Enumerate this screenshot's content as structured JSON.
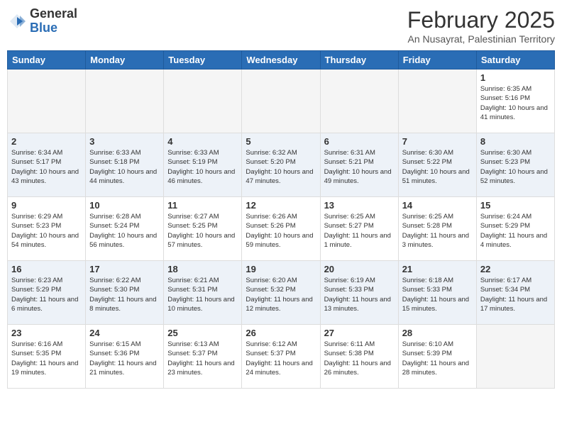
{
  "header": {
    "logo_general": "General",
    "logo_blue": "Blue",
    "month_title": "February 2025",
    "subtitle": "An Nusayrat, Palestinian Territory"
  },
  "days_of_week": [
    "Sunday",
    "Monday",
    "Tuesday",
    "Wednesday",
    "Thursday",
    "Friday",
    "Saturday"
  ],
  "weeks": [
    {
      "days": [
        {
          "num": "",
          "info": ""
        },
        {
          "num": "",
          "info": ""
        },
        {
          "num": "",
          "info": ""
        },
        {
          "num": "",
          "info": ""
        },
        {
          "num": "",
          "info": ""
        },
        {
          "num": "",
          "info": ""
        },
        {
          "num": "1",
          "info": "Sunrise: 6:35 AM\nSunset: 5:16 PM\nDaylight: 10 hours and 41 minutes."
        }
      ]
    },
    {
      "days": [
        {
          "num": "2",
          "info": "Sunrise: 6:34 AM\nSunset: 5:17 PM\nDaylight: 10 hours and 43 minutes."
        },
        {
          "num": "3",
          "info": "Sunrise: 6:33 AM\nSunset: 5:18 PM\nDaylight: 10 hours and 44 minutes."
        },
        {
          "num": "4",
          "info": "Sunrise: 6:33 AM\nSunset: 5:19 PM\nDaylight: 10 hours and 46 minutes."
        },
        {
          "num": "5",
          "info": "Sunrise: 6:32 AM\nSunset: 5:20 PM\nDaylight: 10 hours and 47 minutes."
        },
        {
          "num": "6",
          "info": "Sunrise: 6:31 AM\nSunset: 5:21 PM\nDaylight: 10 hours and 49 minutes."
        },
        {
          "num": "7",
          "info": "Sunrise: 6:30 AM\nSunset: 5:22 PM\nDaylight: 10 hours and 51 minutes."
        },
        {
          "num": "8",
          "info": "Sunrise: 6:30 AM\nSunset: 5:23 PM\nDaylight: 10 hours and 52 minutes."
        }
      ]
    },
    {
      "days": [
        {
          "num": "9",
          "info": "Sunrise: 6:29 AM\nSunset: 5:23 PM\nDaylight: 10 hours and 54 minutes."
        },
        {
          "num": "10",
          "info": "Sunrise: 6:28 AM\nSunset: 5:24 PM\nDaylight: 10 hours and 56 minutes."
        },
        {
          "num": "11",
          "info": "Sunrise: 6:27 AM\nSunset: 5:25 PM\nDaylight: 10 hours and 57 minutes."
        },
        {
          "num": "12",
          "info": "Sunrise: 6:26 AM\nSunset: 5:26 PM\nDaylight: 10 hours and 59 minutes."
        },
        {
          "num": "13",
          "info": "Sunrise: 6:25 AM\nSunset: 5:27 PM\nDaylight: 11 hours and 1 minute."
        },
        {
          "num": "14",
          "info": "Sunrise: 6:25 AM\nSunset: 5:28 PM\nDaylight: 11 hours and 3 minutes."
        },
        {
          "num": "15",
          "info": "Sunrise: 6:24 AM\nSunset: 5:29 PM\nDaylight: 11 hours and 4 minutes."
        }
      ]
    },
    {
      "days": [
        {
          "num": "16",
          "info": "Sunrise: 6:23 AM\nSunset: 5:29 PM\nDaylight: 11 hours and 6 minutes."
        },
        {
          "num": "17",
          "info": "Sunrise: 6:22 AM\nSunset: 5:30 PM\nDaylight: 11 hours and 8 minutes."
        },
        {
          "num": "18",
          "info": "Sunrise: 6:21 AM\nSunset: 5:31 PM\nDaylight: 11 hours and 10 minutes."
        },
        {
          "num": "19",
          "info": "Sunrise: 6:20 AM\nSunset: 5:32 PM\nDaylight: 11 hours and 12 minutes."
        },
        {
          "num": "20",
          "info": "Sunrise: 6:19 AM\nSunset: 5:33 PM\nDaylight: 11 hours and 13 minutes."
        },
        {
          "num": "21",
          "info": "Sunrise: 6:18 AM\nSunset: 5:33 PM\nDaylight: 11 hours and 15 minutes."
        },
        {
          "num": "22",
          "info": "Sunrise: 6:17 AM\nSunset: 5:34 PM\nDaylight: 11 hours and 17 minutes."
        }
      ]
    },
    {
      "days": [
        {
          "num": "23",
          "info": "Sunrise: 6:16 AM\nSunset: 5:35 PM\nDaylight: 11 hours and 19 minutes."
        },
        {
          "num": "24",
          "info": "Sunrise: 6:15 AM\nSunset: 5:36 PM\nDaylight: 11 hours and 21 minutes."
        },
        {
          "num": "25",
          "info": "Sunrise: 6:13 AM\nSunset: 5:37 PM\nDaylight: 11 hours and 23 minutes."
        },
        {
          "num": "26",
          "info": "Sunrise: 6:12 AM\nSunset: 5:37 PM\nDaylight: 11 hours and 24 minutes."
        },
        {
          "num": "27",
          "info": "Sunrise: 6:11 AM\nSunset: 5:38 PM\nDaylight: 11 hours and 26 minutes."
        },
        {
          "num": "28",
          "info": "Sunrise: 6:10 AM\nSunset: 5:39 PM\nDaylight: 11 hours and 28 minutes."
        },
        {
          "num": "",
          "info": ""
        }
      ]
    }
  ]
}
